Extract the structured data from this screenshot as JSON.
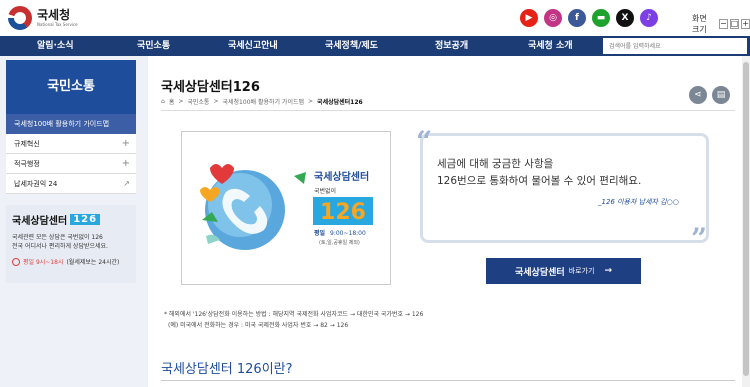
{
  "header": {
    "logo_title": "국세청",
    "logo_sub": "National Tax Service",
    "social": [
      {
        "name": "youtube-icon",
        "glyph": "▶",
        "color": "#e62117"
      },
      {
        "name": "instagram-icon",
        "glyph": "◎",
        "color": "#c13584"
      },
      {
        "name": "facebook-icon",
        "glyph": "f",
        "color": "#3b5998"
      },
      {
        "name": "kakaostory-icon",
        "glyph": "▬",
        "color": "#1fa12e"
      },
      {
        "name": "x-icon",
        "glyph": "X",
        "color": "#111111"
      },
      {
        "name": "blog-icon",
        "glyph": "♪",
        "color": "#7b3fe4"
      }
    ],
    "font_size_label": "화면크기",
    "font_minus": "−",
    "font_reset": "□",
    "font_plus": "+"
  },
  "nav": {
    "items": [
      "알림·소식",
      "국민소통",
      "국세신고안내",
      "국세정책/제도",
      "정보공개",
      "국세청 소개"
    ],
    "search_placeholder": "검색어를 입력하세요"
  },
  "sidebar": {
    "title": "국민소통",
    "items": [
      {
        "label": "국세청100배 활용하기 가이드맵",
        "active": true
      },
      {
        "label": "규제혁신",
        "marker": "+"
      },
      {
        "label": "적극행정",
        "marker": "+"
      },
      {
        "label": "납세자권익 24",
        "marker": "↗"
      }
    ],
    "box": {
      "title": "국세상담센터",
      "number": "126",
      "desc_line1": "국세관련 모든 상담은 국번없이 126",
      "desc_line2": "전국 어디서나 편리하게 상담받으세요.",
      "hours_red": "평일 9시~18시",
      "hours_note": "(월세제보는 24시간)"
    }
  },
  "main": {
    "title": "국세상담센터126",
    "breadcrumb": [
      "홈",
      "국민소통",
      "국세청100배 활용하기 가이드맵",
      "국세상담센터126"
    ],
    "image": {
      "brand": "국세상담센터",
      "sub": "국번없이",
      "number": "126",
      "hours_label": "평일",
      "hours": "9:00~18:00",
      "hours_note": "(토,일,공휴일 제외)"
    },
    "quote_line1": "세금에 대해 궁금한 사항을",
    "quote_line2": "126번으로 통화하여 물어볼 수 있어 편리해요.",
    "quote_signature": "_126 이용자 납세자 김○○",
    "cta_label": "국세상담센터",
    "cta_sub": "바로가기",
    "cta_arrow": "→",
    "note_line1": "* 해외에서 '126'상담전화 이용하는 방법 : 해당지역 국제전화 사업자코드 → 대한민국 국가번호 → 126",
    "note_line2": "(예) 미국에서 전화하는 경우 : 미국 국제전화 사업자 번호 → 82 → 126",
    "section_title": "국세상담센터 126이란?"
  }
}
